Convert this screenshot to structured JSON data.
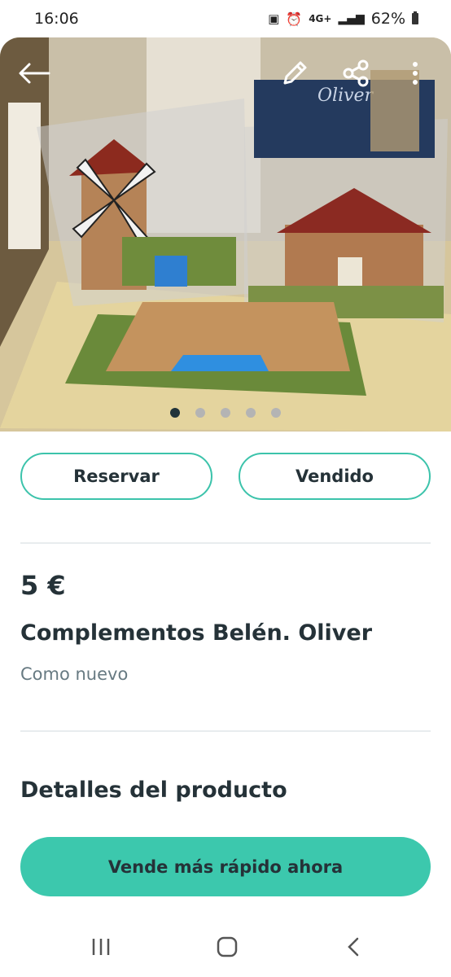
{
  "status_bar": {
    "time": "16:06",
    "network": "4G+",
    "battery": "62%"
  },
  "toolbar": {
    "back_icon": "arrow-left-icon",
    "edit_icon": "pencil-icon",
    "share_icon": "share-icon",
    "more_icon": "more-vertical-icon"
  },
  "gallery": {
    "package_label": "Oliver",
    "page_count": 5,
    "active_index": 0
  },
  "actions": {
    "reserve_label": "Reservar",
    "sold_label": "Vendido"
  },
  "product": {
    "price": "5 €",
    "title": "Complementos Belén.  Oliver",
    "condition": "Como nuevo"
  },
  "details": {
    "heading": "Detalles del producto"
  },
  "cta": {
    "label": "Vende más rápido ahora"
  },
  "colors": {
    "accent": "#3cc8ad",
    "text": "#253238",
    "muted": "#677a82"
  },
  "nav": {
    "recent_icon": "recent-apps-icon",
    "home_icon": "home-icon",
    "back_icon": "nav-back-icon"
  }
}
